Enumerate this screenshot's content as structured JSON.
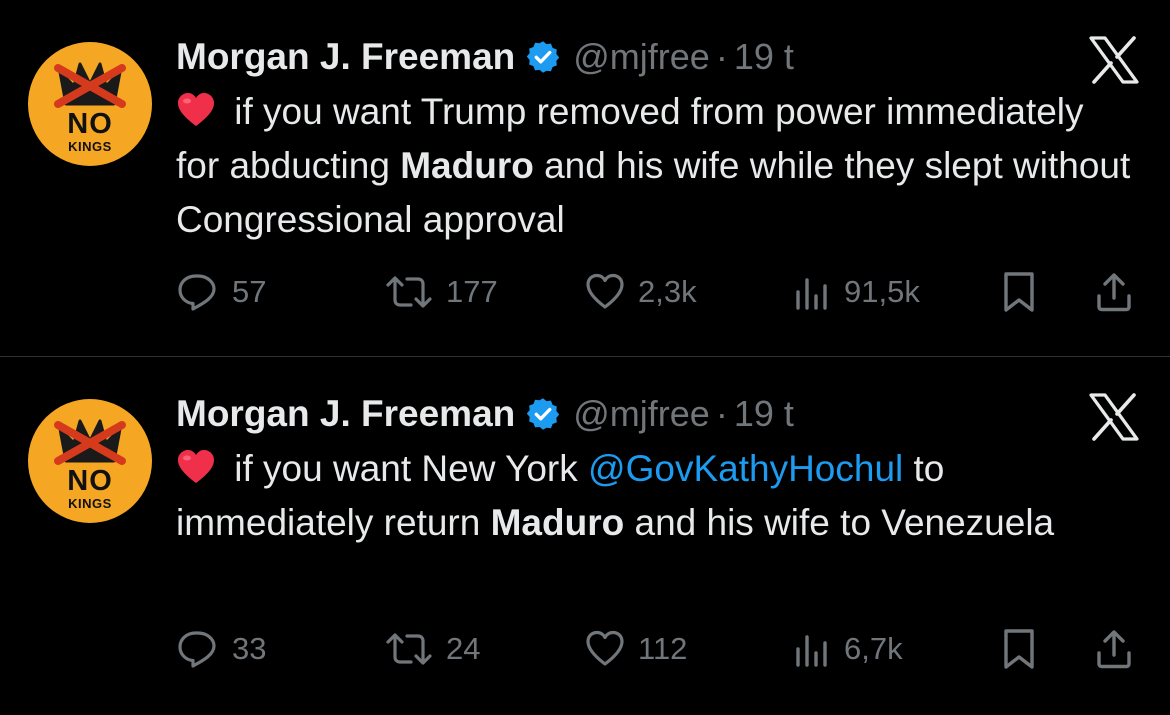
{
  "colors": {
    "background": "#000000",
    "text": "#e7e9ea",
    "muted": "#71767b",
    "accent": "#1d9bf0",
    "divider": "#2f3336",
    "avatar": "#f5a623",
    "heart": "#f0304a"
  },
  "tweets": [
    {
      "avatar": {
        "line1": "NO",
        "line2": "KINGS"
      },
      "author": {
        "name": "Morgan J. Freeman",
        "handle": "@mjfree",
        "separator": "·",
        "time": "19 t"
      },
      "text_parts": [
        {
          "text": " if you want Trump removed from power immediately for abducting "
        },
        {
          "text": "Maduro",
          "bold": true
        },
        {
          "text": " and his wife while they slept without Congressional approval"
        }
      ],
      "stats": {
        "replies": "57",
        "retweets": "177",
        "likes": "2,3k",
        "views": "91,5k"
      }
    },
    {
      "avatar": {
        "line1": "NO",
        "line2": "KINGS"
      },
      "author": {
        "name": "Morgan J. Freeman",
        "handle": "@mjfree",
        "separator": "·",
        "time": "19 t"
      },
      "text_parts": [
        {
          "text": " if you want New York "
        },
        {
          "text": "@GovKathyHochul",
          "mention": true
        },
        {
          "text": " to immediately return "
        },
        {
          "text": "Maduro",
          "bold": true
        },
        {
          "text": " and his wife to Venezuela"
        }
      ],
      "stats": {
        "replies": "33",
        "retweets": "24",
        "likes": "112",
        "views": "6,7k"
      }
    }
  ],
  "icons": {
    "verified": "verified-badge-icon",
    "x_logo": "x-logo-icon",
    "heart_emoji": "red-heart-emoji-icon",
    "reply": "reply-icon",
    "retweet": "retweet-icon",
    "like": "like-icon",
    "views": "views-icon",
    "bookmark": "bookmark-icon",
    "share": "share-icon"
  }
}
